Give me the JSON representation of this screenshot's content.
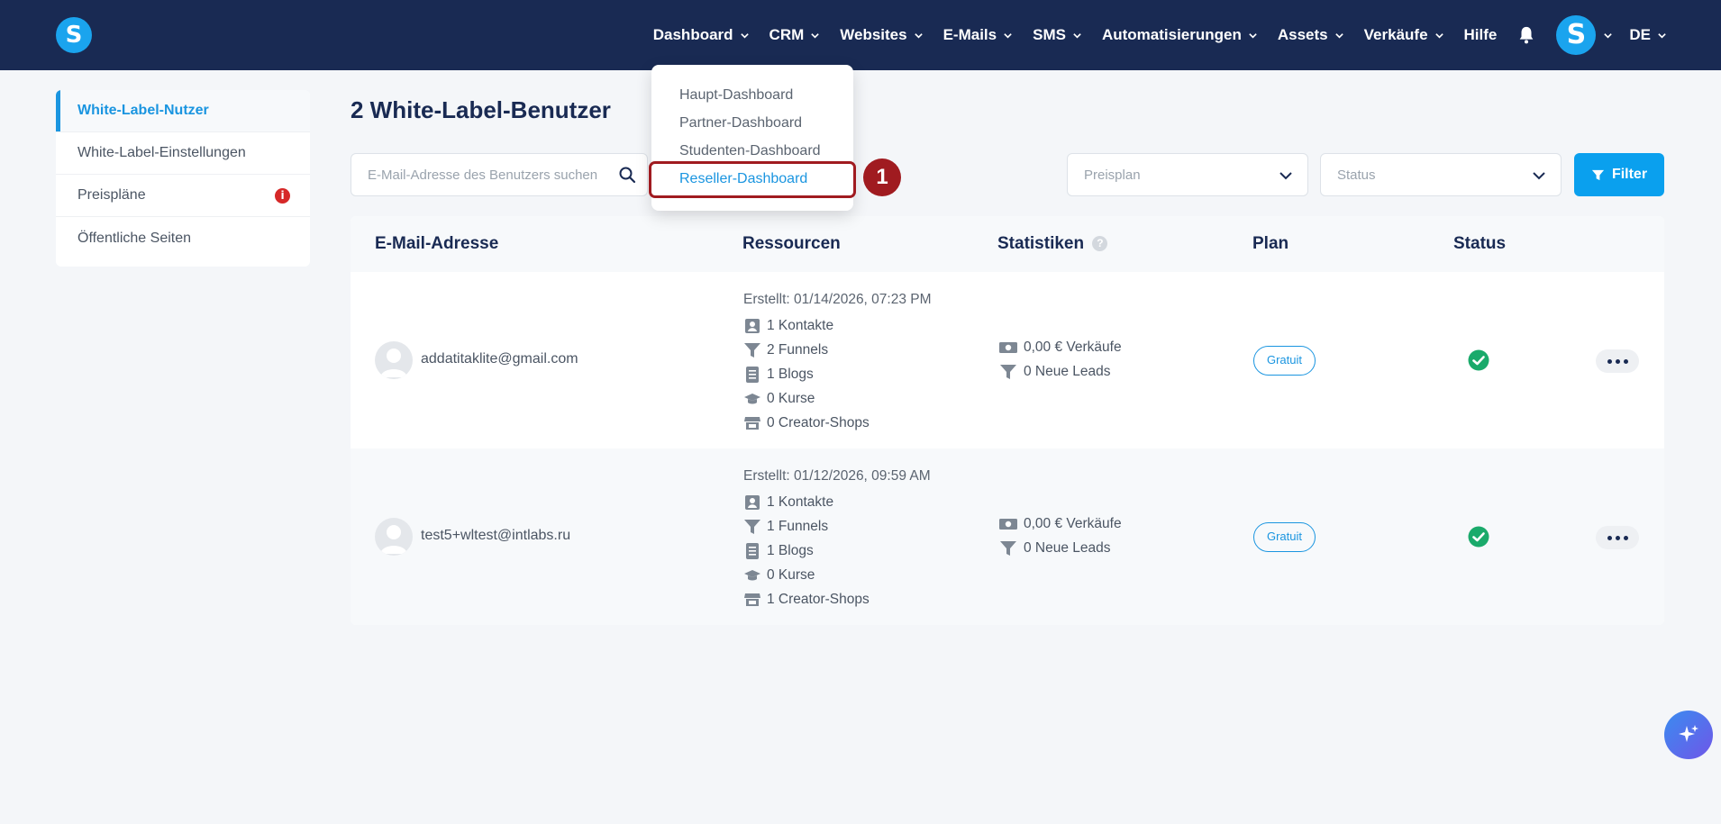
{
  "brand": {
    "logo_letter": "S"
  },
  "nav": {
    "items": [
      {
        "label": "Dashboard"
      },
      {
        "label": "CRM"
      },
      {
        "label": "Websites"
      },
      {
        "label": "E-Mails"
      },
      {
        "label": "SMS"
      },
      {
        "label": "Automatisierungen"
      },
      {
        "label": "Assets"
      },
      {
        "label": "Verkäufe"
      }
    ],
    "help": "Hilfe",
    "avatar_letter": "S",
    "language": "DE"
  },
  "dashboard_menu": {
    "items": [
      {
        "label": "Haupt-Dashboard"
      },
      {
        "label": "Partner-Dashboard"
      },
      {
        "label": "Studenten-Dashboard"
      },
      {
        "label": "Reseller-Dashboard"
      }
    ],
    "step_number": "1"
  },
  "sidebar": {
    "items": [
      {
        "label": "White-Label-Nutzer"
      },
      {
        "label": "White-Label-Einstellungen"
      },
      {
        "label": "Preispläne"
      },
      {
        "label": "Öffentliche Seiten"
      }
    ],
    "warning_glyph": "i"
  },
  "main": {
    "title": "2 White-Label-Benutzer",
    "search_placeholder": "E-Mail-Adresse des Benutzers suchen",
    "plan_filter_placeholder": "Preisplan",
    "status_filter_placeholder": "Status",
    "filter_label": "Filter"
  },
  "table": {
    "headers": {
      "email": "E-Mail-Adresse",
      "resources": "Ressourcen",
      "stats": "Statistiken",
      "stats_help": "?",
      "plan": "Plan",
      "status": "Status"
    },
    "rows": [
      {
        "email": "addatitaklite@gmail.com",
        "created": "Erstellt: 01/14/2026, 07:23 PM",
        "contacts": "1 Kontakte",
        "funnels": "2 Funnels",
        "blogs": "1 Blogs",
        "courses": "0 Kurse",
        "shops": "0 Creator-Shops",
        "sales": "0,00 € Verkäufe",
        "leads": "0 Neue Leads",
        "plan": "Gratuit",
        "status": "active"
      },
      {
        "email": "test5+wltest@intlabs.ru",
        "created": "Erstellt: 01/12/2026, 09:59 AM",
        "contacts": "1 Kontakte",
        "funnels": "1 Funnels",
        "blogs": "1 Blogs",
        "courses": "0 Kurse",
        "shops": "1 Creator-Shops",
        "sales": "0,00 € Verkäufe",
        "leads": "0 Neue Leads",
        "plan": "Gratuit",
        "status": "active"
      }
    ]
  },
  "colors": {
    "topbar": "#192a53",
    "accent": "#1a95e0",
    "filter_button": "#0aa0ee",
    "highlight": "#a01b20",
    "success": "#1aaa6b"
  },
  "icons": {
    "chevron": "chevron-down-icon",
    "bell": "bell-icon",
    "search": "search-icon",
    "filter": "filter-icon",
    "contacts": "contact-card-icon",
    "funnel": "funnel-icon",
    "blog": "document-icon",
    "course": "graduation-cap-icon",
    "shop": "store-icon",
    "sales": "money-icon",
    "status": "check-circle-icon",
    "more": "more-dots-icon",
    "ai": "sparkle-icon"
  }
}
